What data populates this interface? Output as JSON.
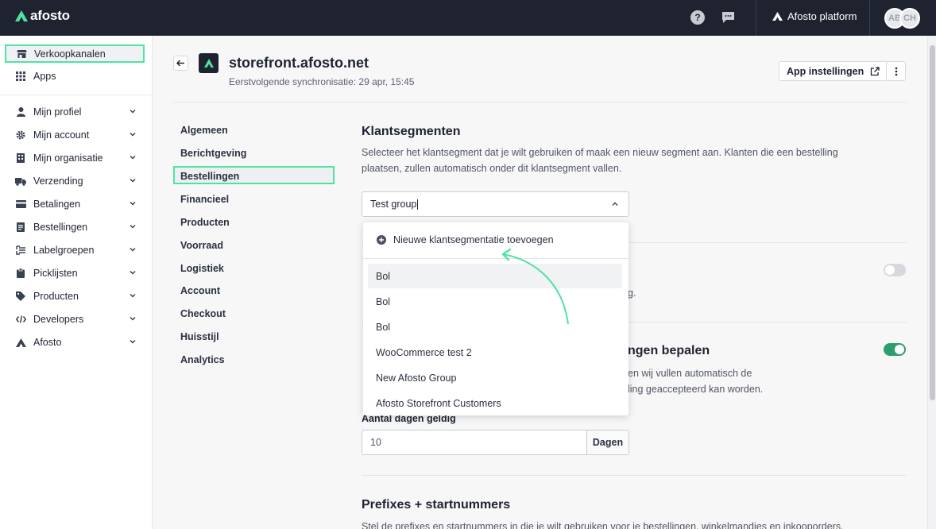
{
  "topbar": {
    "logo_text": "afosto",
    "help_symbol": "?",
    "platform_label": "Afosto platform",
    "avatars": [
      "AB",
      "CH"
    ]
  },
  "sidebar": {
    "top_items": [
      {
        "label": "Verkoopkanalen",
        "icon": "storefront-icon",
        "active": true
      },
      {
        "label": "Apps",
        "icon": "grid-icon",
        "active": false
      }
    ],
    "items": [
      {
        "label": "Mijn profiel",
        "icon": "person-icon"
      },
      {
        "label": "Mijn account",
        "icon": "gear-icon"
      },
      {
        "label": "Mijn organisatie",
        "icon": "building-icon"
      },
      {
        "label": "Verzending",
        "icon": "truck-icon"
      },
      {
        "label": "Betalingen",
        "icon": "credit-card-icon"
      },
      {
        "label": "Bestellingen",
        "icon": "receipt-icon"
      },
      {
        "label": "Labelgroepen",
        "icon": "tags-icon"
      },
      {
        "label": "Picklijsten",
        "icon": "clipboard-icon"
      },
      {
        "label": "Producten",
        "icon": "tag-icon"
      },
      {
        "label": "Developers",
        "icon": "code-icon"
      },
      {
        "label": "Afosto",
        "icon": "afosto-logo-icon"
      }
    ]
  },
  "header": {
    "title": "storefront.afosto.net",
    "subtitle": "Eerstvolgende synchronisatie: 29 apr, 15:45",
    "app_settings_label": "App instellingen"
  },
  "subnav": {
    "items": [
      "Algemeen",
      "Berichtgeving",
      "Bestellingen",
      "Financieel",
      "Producten",
      "Voorraad",
      "Logistiek",
      "Account",
      "Checkout",
      "Huisstijl",
      "Analytics"
    ],
    "active": "Bestellingen"
  },
  "segment_section": {
    "title": "Klantsegmenten",
    "description": "Selecteer het klantsegment dat je wilt gebruiken of maak een nieuw segment aan. Klanten die een bestelling plaatsen, zullen automatisch onder dit klantsegment vallen.",
    "selected_value": "Test group",
    "dropdown": {
      "add_label": "Nieuwe klantsegmentatie toevoegen",
      "options": [
        "Bol",
        "Bol",
        "Bol",
        "WooCommerce test 2",
        "New Afosto Group",
        "Afosto Storefront Customers"
      ]
    }
  },
  "obscured_section_1": {
    "text_fragment": "g.",
    "toggle_on": false
  },
  "obscured_section_2": {
    "title_fragment": "ngen bepalen",
    "desc_line1_fragment": "en wij vullen automatisch de",
    "desc_line2_fragment": "ling geaccepteerd kan worden.",
    "toggle_on": true
  },
  "days_field": {
    "label": "Aantal dagen geldig",
    "value": "10",
    "addon": "Dagen"
  },
  "prefix_section": {
    "title": "Prefixes + startnummers",
    "description": "Stel de prefixes en startnummers in die je wilt gebruiken voor je bestellingen, winkelmandjes en inkooporders."
  },
  "colors": {
    "accent": "#4fe3a0",
    "topbar": "#1f2330",
    "toggle_on": "#2f9e6e",
    "arrow": "#4fe3a0"
  }
}
